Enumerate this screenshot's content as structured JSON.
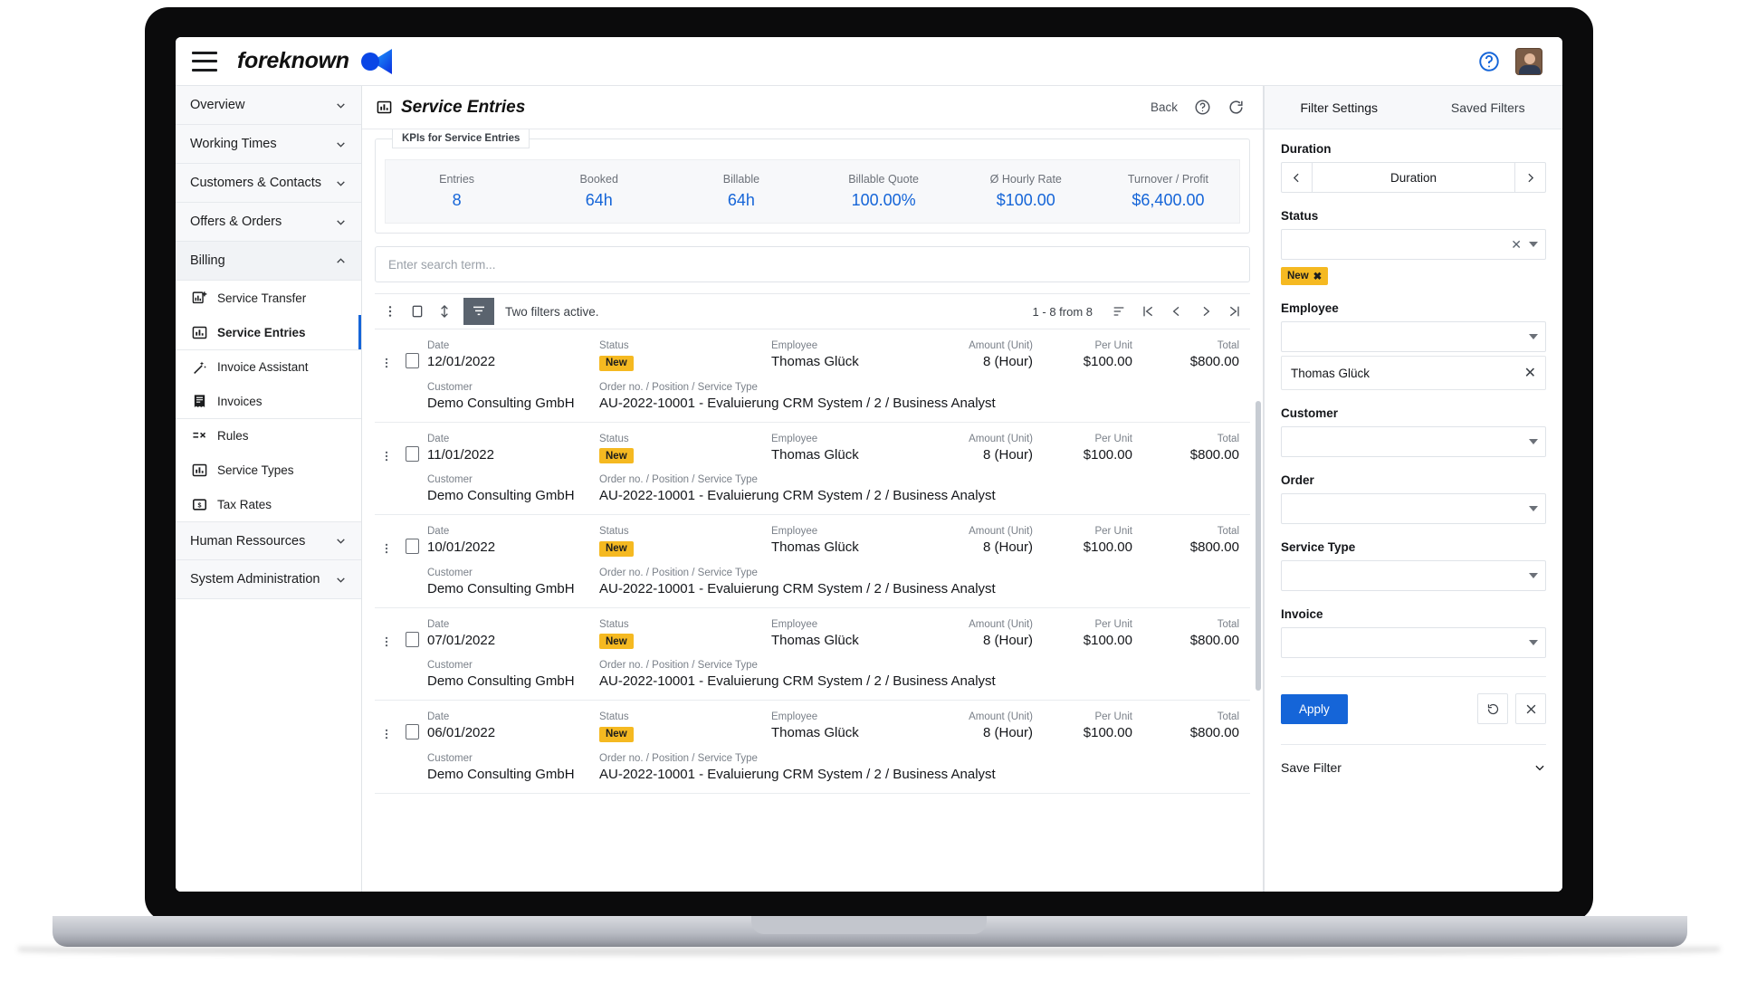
{
  "topbar": {
    "menu_icon": "hamburger-icon",
    "brand": "foreknown",
    "help_icon": "help-circle-icon",
    "avatar_icon": "user-avatar"
  },
  "sidebar": {
    "groups": [
      {
        "label": "Overview",
        "expanded": false
      },
      {
        "label": "Working Times",
        "expanded": false
      },
      {
        "label": "Customers & Contacts",
        "expanded": false
      },
      {
        "label": "Offers & Orders",
        "expanded": false
      },
      {
        "label": "Billing",
        "expanded": true
      }
    ],
    "billing_items": [
      {
        "label": "Service Transfer",
        "icon": "chart-plus-icon",
        "active": false
      },
      {
        "label": "Service Entries",
        "icon": "chart-bar-icon",
        "active": true
      },
      {
        "label": "Invoice Assistant",
        "icon": "magic-wand-icon",
        "active": false
      },
      {
        "label": "Invoices",
        "icon": "receipt-icon",
        "active": false
      },
      {
        "label": "Rules",
        "icon": "rules-icon",
        "active": false
      },
      {
        "label": "Service Types",
        "icon": "chart-bar-icon",
        "active": false
      },
      {
        "label": "Tax Rates",
        "icon": "money-icon",
        "active": false
      }
    ],
    "bottom_groups": [
      {
        "label": "Human Ressources",
        "expanded": false
      },
      {
        "label": "System Administration",
        "expanded": false
      }
    ]
  },
  "main": {
    "title": "Service Entries",
    "title_icon": "chart-bar-icon",
    "back_label": "Back",
    "help_icon": "help-circle-icon",
    "refresh_icon": "refresh-icon",
    "kpi_legend": "KPIs for Service Entries",
    "kpis": [
      {
        "label": "Entries",
        "value": "8"
      },
      {
        "label": "Booked",
        "value": "64h"
      },
      {
        "label": "Billable",
        "value": "64h"
      },
      {
        "label": "Billable Quote",
        "value": "100.00%"
      },
      {
        "label": "Ø Hourly Rate",
        "value": "$100.00"
      },
      {
        "label": "Turnover / Profit",
        "value": "$6,400.00"
      }
    ],
    "search_placeholder": "Enter search term...",
    "toolbar": {
      "more_icon": "kebab-menu-icon",
      "select_all_icon": "checkbox-icon",
      "sort_icon": "sort-updown-icon",
      "filter_icon": "funnel-icon",
      "filter_text": "Two filters active.",
      "range_text": "1 - 8 from 8",
      "list_sort_icon": "sort-lines-icon",
      "first_icon": "page-first-icon",
      "prev_icon": "page-prev-icon",
      "next_icon": "page-next-icon",
      "last_icon": "page-last-icon"
    },
    "column_captions": {
      "date": "Date",
      "status": "Status",
      "employee": "Employee",
      "amount": "Amount (Unit)",
      "per_unit": "Per Unit",
      "total": "Total",
      "customer": "Customer",
      "order": "Order no. / Position / Service Type"
    },
    "rows": [
      {
        "date": "12/01/2022",
        "status": "New",
        "employee": "Thomas Glück",
        "amount": "8 (Hour)",
        "per_unit": "$100.00",
        "total": "$800.00",
        "customer": "Demo Consulting GmbH",
        "order": "AU-2022-10001 - Evaluierung CRM System / 2 / Business Analyst"
      },
      {
        "date": "11/01/2022",
        "status": "New",
        "employee": "Thomas Glück",
        "amount": "8 (Hour)",
        "per_unit": "$100.00",
        "total": "$800.00",
        "customer": "Demo Consulting GmbH",
        "order": "AU-2022-10001 - Evaluierung CRM System / 2 / Business Analyst"
      },
      {
        "date": "10/01/2022",
        "status": "New",
        "employee": "Thomas Glück",
        "amount": "8 (Hour)",
        "per_unit": "$100.00",
        "total": "$800.00",
        "customer": "Demo Consulting GmbH",
        "order": "AU-2022-10001 - Evaluierung CRM System / 2 / Business Analyst"
      },
      {
        "date": "07/01/2022",
        "status": "New",
        "employee": "Thomas Glück",
        "amount": "8 (Hour)",
        "per_unit": "$100.00",
        "total": "$800.00",
        "customer": "Demo Consulting GmbH",
        "order": "AU-2022-10001 - Evaluierung CRM System / 2 / Business Analyst"
      },
      {
        "date": "06/01/2022",
        "status": "New",
        "employee": "Thomas Glück",
        "amount": "8 (Hour)",
        "per_unit": "$100.00",
        "total": "$800.00",
        "customer": "Demo Consulting GmbH",
        "order": "AU-2022-10001 - Evaluierung CRM System / 2 / Business Analyst"
      }
    ]
  },
  "filters": {
    "tabs": [
      {
        "label": "Filter Settings",
        "active": true
      },
      {
        "label": "Saved Filters",
        "active": false
      }
    ],
    "duration": {
      "label": "Duration",
      "value": "Duration",
      "prev_icon": "chevron-left-icon",
      "next_icon": "chevron-right-icon"
    },
    "status": {
      "label": "Status",
      "value": "",
      "chip": "New",
      "chip_remove_icon": "close-icon"
    },
    "employee": {
      "label": "Employee",
      "value": "",
      "token": "Thomas Glück",
      "token_remove_icon": "close-icon"
    },
    "customer": {
      "label": "Customer",
      "value": ""
    },
    "order": {
      "label": "Order",
      "value": ""
    },
    "service_type": {
      "label": "Service Type",
      "value": ""
    },
    "invoice": {
      "label": "Invoice",
      "value": ""
    },
    "apply_label": "Apply",
    "reset_icon": "reset-icon",
    "clear_icon": "clear-x-icon",
    "save_filter_label": "Save Filter",
    "save_filter_chevron": "chevron-down-icon"
  },
  "colors": {
    "accent": "#1565d8",
    "badge": "#f5b921",
    "toolbar_active": "#5a636e"
  }
}
